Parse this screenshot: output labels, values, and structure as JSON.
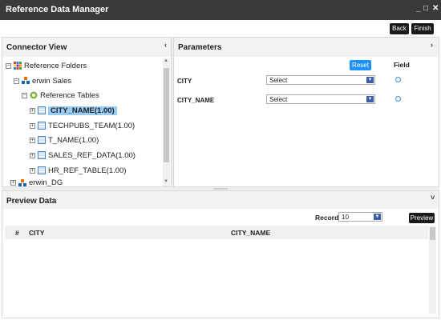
{
  "window": {
    "title": "Reference Data Manager",
    "minimize": "_",
    "maximize": "□",
    "close": "✕"
  },
  "toolbar": {
    "back_label": "Back",
    "finish_label": "Finish"
  },
  "connector_view": {
    "title": "Connector View",
    "collapse_glyph": "‹",
    "tree": {
      "root": "Reference Folders",
      "folder": "erwin Sales",
      "group": "Reference Tables",
      "tables": [
        "CITY_NAME(1.00)",
        "TECHPUBS_TEAM(1.00)",
        "T_NAME(1.00)",
        "SALES_REF_DATA(1.00)",
        "HR_REF_TABLE(1.00)"
      ],
      "selected_index": 0,
      "next_folder": "erwin_DG"
    }
  },
  "parameters": {
    "title": "Parameters",
    "expand_glyph": "›",
    "reset_label": "Reset",
    "field_header": "Field",
    "rows": [
      {
        "label": "CITY",
        "value": "Select"
      },
      {
        "label": "CITY_NAME",
        "value": "Select"
      }
    ]
  },
  "preview": {
    "title": "Preview Data",
    "collapse_glyph": "˅",
    "records_label": "Records",
    "records_value": "10",
    "preview_label": "Preview",
    "columns": [
      "#",
      "CITY",
      "CITY_NAME"
    ]
  },
  "colors": {
    "titlebar": "#3a3a3a",
    "accent": "#1e90ff",
    "selection": "#99ccf5"
  }
}
